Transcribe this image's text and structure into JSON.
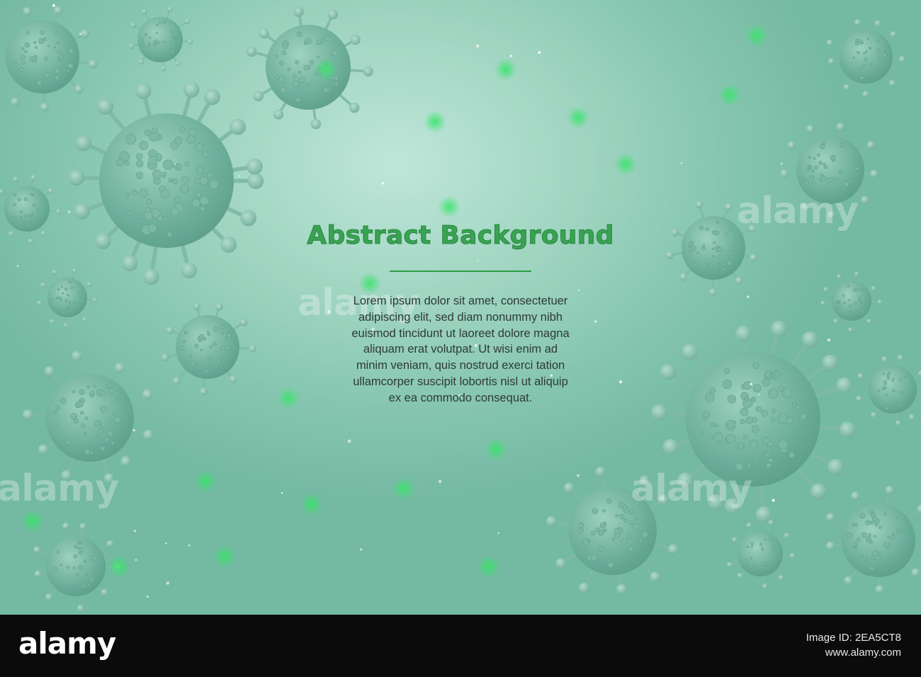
{
  "headline": "Abstract Background",
  "body_lines": [
    "Lorem ipsum dolor sit amet, consectetuer",
    "adipiscing elit, sed diam nonummy nibh",
    "euismod tincidunt ut laoreet dolore magna",
    "aliquam erat volutpat. Ut wisi enim ad",
    "minim veniam, quis nostrud exerci tation",
    "ullamcorper suscipit lobortis nisl ut aliquip",
    "ex ea commodo consequat."
  ],
  "watermark": "alamy",
  "footer": {
    "logo": "alamy",
    "image_id": "Image ID: 2EA5CT8",
    "site": "www.alamy.com"
  },
  "colors": {
    "headline": "#3aa253",
    "divider": "#2f9b4a",
    "background_light": "#bfe6d9",
    "background_dark": "#74b9a2",
    "virus": "#6aad98",
    "glow": "#39e56b",
    "footer": "#0b0b0b"
  }
}
